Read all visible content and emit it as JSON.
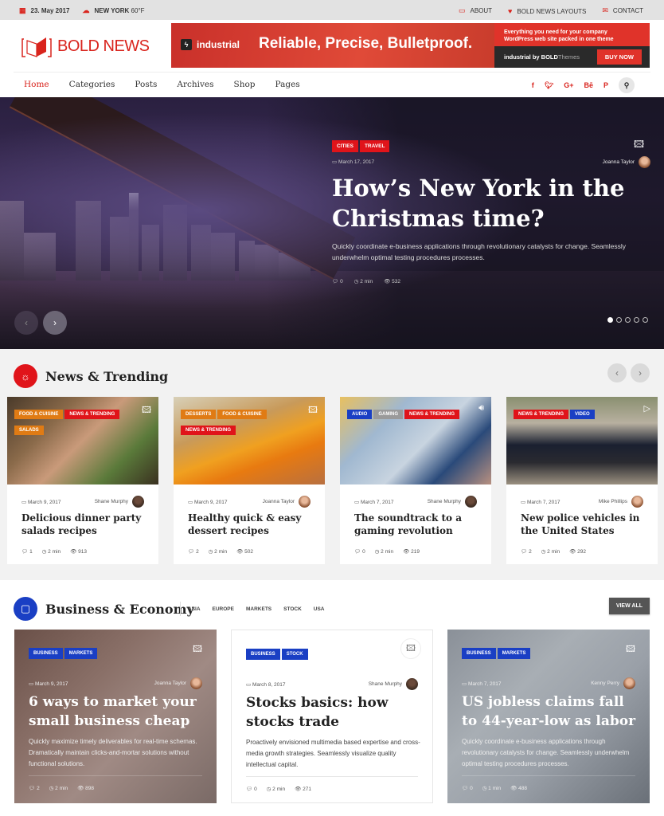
{
  "topbar": {
    "date": "23. May 2017",
    "city": "NEW YORK",
    "temperature": "60°F",
    "links": [
      {
        "label": "ABOUT",
        "icon": "card-icon"
      },
      {
        "label": "BOLD NEWS LAYOUTS",
        "icon": "heart-icon"
      },
      {
        "label": "CONTACT",
        "icon": "envelope-icon"
      }
    ]
  },
  "logo": {
    "text": "BOLD NEWS"
  },
  "banner": {
    "brand": "industrial",
    "slogan": "Reliable, Precise, Bulletproof.",
    "tagline_line1": "Everything you need for your company",
    "tagline_line2": "WordPress web site packed in one theme",
    "byline_bold": "industrial by BOLD",
    "byline_thin": "Themes",
    "cta": "BUY NOW"
  },
  "nav": {
    "items": [
      "Home",
      "Categories",
      "Posts",
      "Archives",
      "Shop",
      "Pages"
    ],
    "active": "Home",
    "social": [
      "f",
      "t",
      "G+",
      "Bē",
      "P"
    ]
  },
  "hero": {
    "tags": [
      "CITIES",
      "TRAVEL"
    ],
    "date": "March 17, 2017",
    "author": "Joanna Taylor",
    "title": "How’s New York in the Christmas time?",
    "excerpt": "Quickly coordinate e-business applications through revolutionary catalysts for change. Seamlessly underwhelm optimal testing procedures processes.",
    "comments": "0",
    "read_time": "2 min",
    "views": "532",
    "slides": 5,
    "active_slide": 1
  },
  "news_trending": {
    "title": "News & Trending",
    "cards": [
      {
        "tags": [
          {
            "label": "FOOD & CUISINE",
            "color": "orange"
          },
          {
            "label": "NEWS & TRENDING",
            "color": "red"
          },
          {
            "label": "SALADS",
            "color": "orange"
          }
        ],
        "media": "image",
        "date": "March 9, 2017",
        "author": "Shane Murphy",
        "title": "Delicious dinner party salads recipes",
        "comments": "1",
        "read_time": "2 min",
        "views": "913"
      },
      {
        "tags": [
          {
            "label": "DESSERTS",
            "color": "orange"
          },
          {
            "label": "FOOD & CUISINE",
            "color": "orange"
          },
          {
            "label": "NEWS & TRENDING",
            "color": "red"
          }
        ],
        "media": "image",
        "date": "March 9, 2017",
        "author": "Joanna Taylor",
        "title": "Healthy quick & easy dessert recipes",
        "comments": "2",
        "read_time": "2 min",
        "views": "502"
      },
      {
        "tags": [
          {
            "label": "AUDIO",
            "color": "blue"
          },
          {
            "label": "GAMING",
            "color": "gray"
          },
          {
            "label": "NEWS & TRENDING",
            "color": "red"
          }
        ],
        "media": "audio",
        "date": "March 7, 2017",
        "author": "Shane Murphy",
        "title": "The soundtrack to a gaming revolution",
        "comments": "0",
        "read_time": "2 min",
        "views": "219"
      },
      {
        "tags": [
          {
            "label": "NEWS & TRENDING",
            "color": "red"
          },
          {
            "label": "VIDEO",
            "color": "blue"
          }
        ],
        "media": "video",
        "date": "March 7, 2017",
        "author": "Mike Phillips",
        "title": "New police vehicles in the United States",
        "comments": "2",
        "read_time": "2 min",
        "views": "292"
      }
    ]
  },
  "business": {
    "title": "Business & Economy",
    "filters": [
      "ASIA",
      "EUROPE",
      "MARKETS",
      "STOCK",
      "USA"
    ],
    "view_all": "VIEW ALL",
    "cards": [
      {
        "tags": [
          "BUSINESS",
          "MARKETS"
        ],
        "date": "March 9, 2017",
        "author": "Joanna Taylor",
        "title": "6 ways to market your small business cheap",
        "excerpt": "Quickly maximize timely deliverables for real-time schemas. Dramatically maintain clicks-and-mortar solutions without functional solutions.",
        "comments": "2",
        "read_time": "2 min",
        "views": "898"
      },
      {
        "tags": [
          "BUSINESS",
          "STOCK"
        ],
        "date": "March 8, 2017",
        "author": "Shane Murphy",
        "title": "Stocks basics: how stocks trade",
        "excerpt": "Proactively envisioned multimedia based expertise and cross-media growth strategies. Seamlessly visualize quality intellectual capital.",
        "comments": "0",
        "read_time": "2 min",
        "views": "271"
      },
      {
        "tags": [
          "BUSINESS",
          "MARKETS"
        ],
        "date": "March 7, 2017",
        "author": "Kenny Perry",
        "title": "US jobless claims fall to 44-year-low as labor",
        "excerpt": "Quickly coordinate e-business applications through revolutionary catalysts for change. Seamlessly underwhelm optimal testing procedures processes.",
        "comments": "0",
        "read_time": "1 min",
        "views": "488"
      }
    ]
  },
  "colors": {
    "brand_red": "#d9241d",
    "tag_red": "#e0141a",
    "tag_orange": "#e07b14",
    "tag_blue": "#1a3fc4",
    "tag_gray": "#9a9a9a"
  }
}
